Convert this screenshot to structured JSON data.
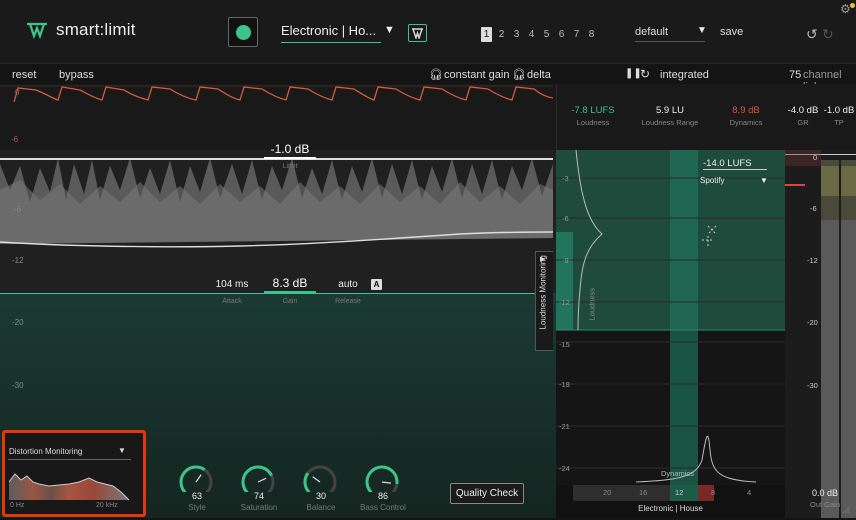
{
  "header": {
    "app_name": "smart:limit",
    "profile": "Electronic | Ho...",
    "slots": [
      "1",
      "2",
      "3",
      "4",
      "5",
      "6",
      "7",
      "8"
    ],
    "active_slot": "1",
    "preset": "default",
    "save_label": "save"
  },
  "subbar": {
    "reset": "reset",
    "bypass": "bypass",
    "constant_gain": "constant gain",
    "delta": "delta",
    "integrated": "integrated",
    "channel_link_value": "75",
    "channel_link_label": "channel link"
  },
  "metrics": [
    {
      "value": "-7.8 LUFS",
      "label": "Loudness",
      "color": "#3cc48d"
    },
    {
      "value": "5.9 LU",
      "label": "Loudness Range",
      "color": "#eeeeee"
    },
    {
      "value": "8.9 dB",
      "label": "Dynamics",
      "color": "#e0523c"
    },
    {
      "value": "-4.0 dB",
      "label": "GR",
      "color": "#eeeeee"
    },
    {
      "value": "-1.0 dB",
      "label": "TP",
      "color": "#eeeeee"
    }
  ],
  "gr_axis": [
    "0",
    "-6"
  ],
  "main_axis": [
    "-6",
    "-12",
    "-20",
    "-30"
  ],
  "limit": {
    "value": "-1.0 dB",
    "label": "Limit"
  },
  "params": {
    "attack_value": "104 ms",
    "attack_label": "Attack",
    "gain_value": "8.3 dB",
    "gain_label": "Gain",
    "release_value": "auto",
    "release_label": "Release",
    "auto_badge": "A"
  },
  "loudness_monitoring_tab": "Loudness Monitoring",
  "distortion": {
    "title": "Distortion Monitoring",
    "x_min": "0 Hz",
    "x_max": "20 kHz"
  },
  "knobs": [
    {
      "value": "63",
      "label": "Style",
      "level": 0.63
    },
    {
      "value": "74",
      "label": "Saturation",
      "level": 0.74
    },
    {
      "value": "30",
      "label": "Balance",
      "level": 0.3
    },
    {
      "value": "86",
      "label": "Bass Control",
      "level": 0.86
    }
  ],
  "quality_check": "Quality Check",
  "loudness_map": {
    "target": "-14.0 LUFS",
    "platform": "Spotify",
    "y_ticks": [
      "-3",
      "-6",
      "-9",
      "-12",
      "-15",
      "-18",
      "-21",
      "-24"
    ],
    "x_ticks": [
      "20",
      "16",
      "12",
      "8",
      "4"
    ],
    "loudness_axis": "Loudness",
    "dynamics_axis": "Dynamics",
    "footer": "Electronic | House"
  },
  "meters": {
    "ticks": [
      "0",
      "-6",
      "-12",
      "-20",
      "-30"
    ],
    "out_gain_value": "0.0 dB",
    "out_gain_label": "Out Gain"
  },
  "colors": {
    "accent": "#3cc48d",
    "warning": "#e0523c",
    "highlight_border": "#e8350b"
  }
}
